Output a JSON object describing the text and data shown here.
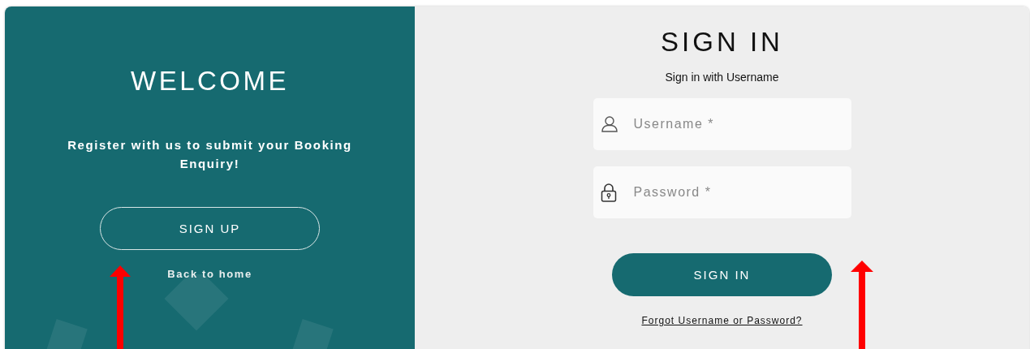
{
  "welcome": {
    "title": "WELCOME",
    "message": "Register with us to submit your Booking Enquiry!",
    "signup_button": "SIGN UP",
    "home_link": "Back to home"
  },
  "sign_in": {
    "title": "SIGN IN",
    "subtitle": "Sign in with Username",
    "fields": [
      {
        "kind": "username",
        "placeholder": "Username *"
      },
      {
        "kind": "password",
        "placeholder": "Password *"
      }
    ],
    "button": "SIGN IN",
    "forgot_link": "Forgot Username or Password?"
  }
}
